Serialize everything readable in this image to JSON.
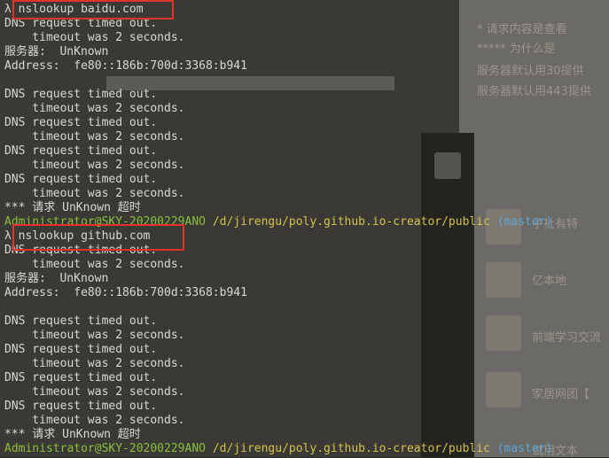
{
  "terminal": {
    "block1": {
      "command": "λ nslookup baidu.com",
      "line1": "DNS request timed out.",
      "line2": "    timeout was 2 seconds.",
      "server": "服务器:  UnKnown",
      "address": "Address:  fe80::186b:700d:3368:b941",
      "repeat": [
        "DNS request timed out.",
        "    timeout was 2 seconds.",
        "DNS request timed out.",
        "    timeout was 2 seconds.",
        "DNS request timed out.",
        "    timeout was 2 seconds.",
        "DNS request timed out.",
        "    timeout was 2 seconds."
      ],
      "final": "*** 请求 UnKnown 超时"
    },
    "prompt1": {
      "user": "Administrator@SKY-20200229ANO",
      "path": "/d/jirengu/poly.github.io-creator/public",
      "branch": "(master)"
    },
    "block2": {
      "command": "λ nslookup github.com",
      "line1": "DNS request timed out.",
      "line2": "    timeout was 2 seconds.",
      "server": "服务器:  UnKnown",
      "address": "Address:  fe80::186b:700d:3368:b941",
      "repeat": [
        "DNS request timed out.",
        "    timeout was 2 seconds.",
        "DNS request timed out.",
        "    timeout was 2 seconds.",
        "DNS request timed out.",
        "    timeout was 2 seconds.",
        "DNS request timed out.",
        "    timeout was 2 seconds."
      ],
      "final": "*** 请求 UnKnown 超时"
    },
    "prompt2": {
      "user": "Administrator@SKY-20200229ANO",
      "path": "/d/jirengu/poly.github.io-creator/public",
      "branch": "(master)"
    }
  },
  "background": {
    "right_lines": [
      "* 请求内容是查看",
      "***** 为什么是",
      "服务器默认用30提供",
      "服务器默认用443提供"
    ],
    "sidebar_items": [
      "子社有特",
      "亿本地",
      "前端学习交流",
      "家居网团【",
      "试用文本"
    ]
  }
}
